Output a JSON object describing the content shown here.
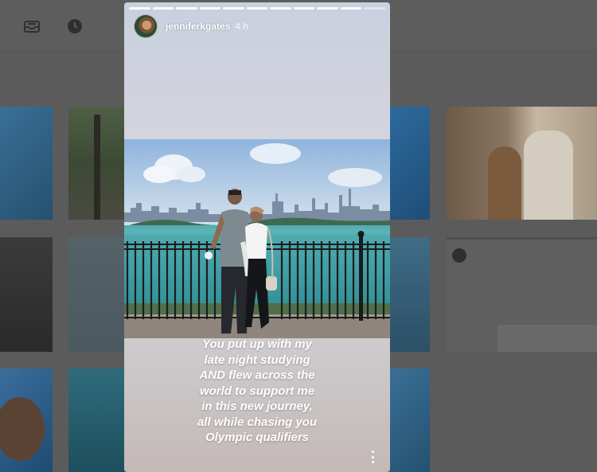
{
  "background": {
    "topbar": {
      "inbox_icon": "inbox-icon",
      "clock_icon": "clock-icon"
    }
  },
  "story": {
    "username": "jenniferkgates",
    "time": "4 h",
    "progress": {
      "segments": 11,
      "active_index": 10
    },
    "photo_alt": "",
    "caption": {
      "lines": [
        "You put up with my",
        "late night studying",
        "AND flew across the",
        "world to support me",
        "in this new journey,",
        "all while chasing you",
        "Olympic qualifiers"
      ]
    },
    "more_icon": "more-vertical-icon"
  }
}
